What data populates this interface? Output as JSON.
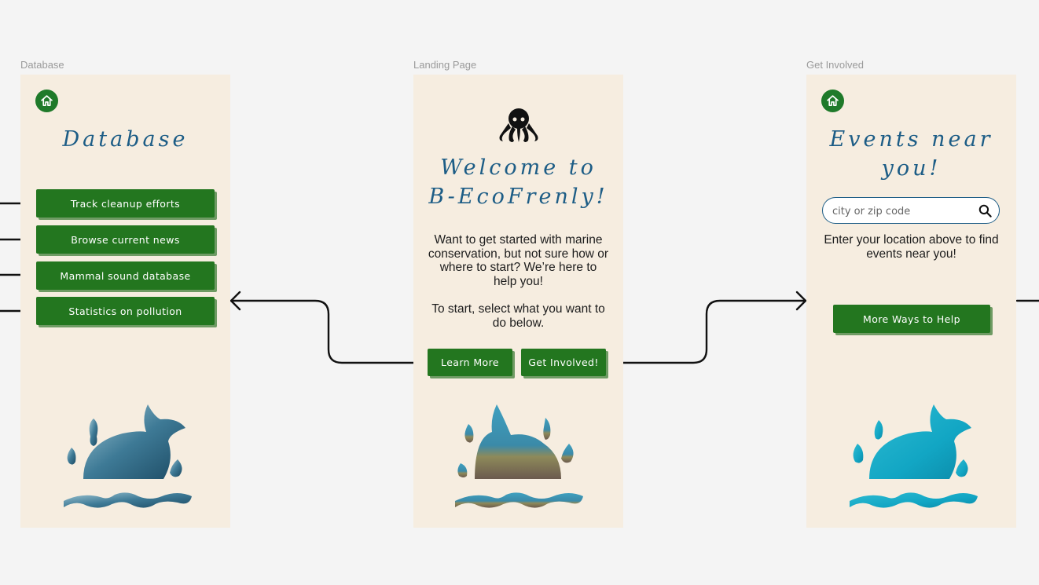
{
  "frames": {
    "database": {
      "label": "Database",
      "title": "Database",
      "buttons": [
        "Track cleanup efforts",
        "Browse current news",
        "Mammal sound database",
        "Statistics on pollution"
      ]
    },
    "landing": {
      "label": "Landing Page",
      "title_line1": "Welcome to",
      "title_line2": "B-EcoFrenly!",
      "intro": "Want to get started with marine conservation, but not sure how or where to start? We’re here to help you!",
      "instruction": "To start, select what you want to do below.",
      "learn_more": "Learn More",
      "get_involved": "Get Involved!"
    },
    "get_involved": {
      "label": "Get Involved",
      "title_line1": "Events near",
      "title_line2": "you!",
      "search_placeholder": "city or zip code",
      "hint": "Enter your location above to find events near you!",
      "more_ways": "More Ways to Help"
    }
  },
  "colors": {
    "frame_bg": "#f6ede0",
    "button_green": "#23761f",
    "title_blue": "#1d5d86",
    "canvas": "#f4f4f4"
  },
  "icons": [
    "home-icon",
    "octopus-icon",
    "search-icon",
    "whale-icon"
  ]
}
